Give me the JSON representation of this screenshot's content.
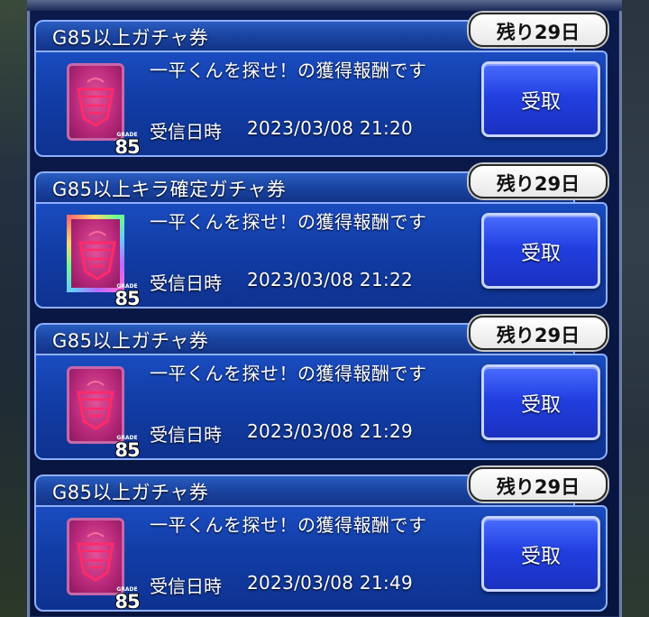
{
  "colors": {
    "panel_bg": "#0a1a4a",
    "card_body": "#1a4cc0",
    "card_border": "#8fb0ff",
    "button": "#2240e0",
    "ticket_pink": "#b8287a"
  },
  "gifts": [
    {
      "title": "G85以上ガチャ券",
      "remaining": "残り29日",
      "message": "一平くんを探せ！の獲得報酬です",
      "received_label": "受信日時",
      "received_at": "2023/03/08 21:20",
      "button_label": "受取",
      "ticket_style": "pink",
      "grade_label": "GRADE",
      "grade": "85"
    },
    {
      "title": "G85以上キラ確定ガチャ券",
      "remaining": "残り29日",
      "message": "一平くんを探せ！の獲得報酬です",
      "received_label": "受信日時",
      "received_at": "2023/03/08 21:22",
      "button_label": "受取",
      "ticket_style": "kira",
      "grade_label": "GRADE",
      "grade": "85"
    },
    {
      "title": "G85以上ガチャ券",
      "remaining": "残り29日",
      "message": "一平くんを探せ！の獲得報酬です",
      "received_label": "受信日時",
      "received_at": "2023/03/08 21:29",
      "button_label": "受取",
      "ticket_style": "pink",
      "grade_label": "GRADE",
      "grade": "85"
    },
    {
      "title": "G85以上ガチャ券",
      "remaining": "残り29日",
      "message": "一平くんを探せ！の獲得報酬です",
      "received_label": "受信日時",
      "received_at": "2023/03/08 21:49",
      "button_label": "受取",
      "ticket_style": "pink",
      "grade_label": "GRADE",
      "grade": "85"
    }
  ]
}
